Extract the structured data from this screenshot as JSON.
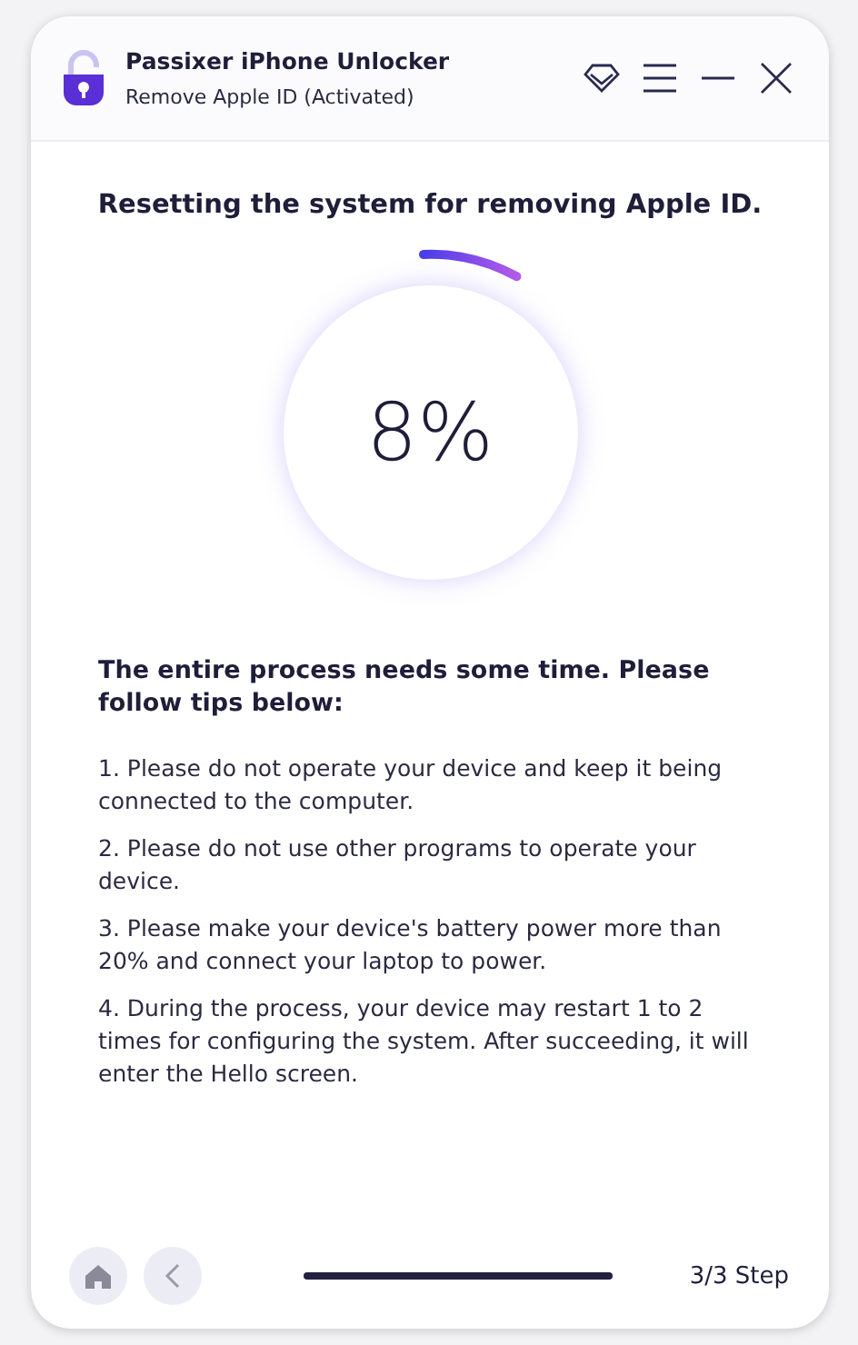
{
  "window": {
    "title": "Passixer iPhone Unlocker",
    "subtitle": "Remove Apple ID  (Activated)"
  },
  "heading": "Resetting the system for removing Apple ID.",
  "progress": {
    "reading": "8%"
  },
  "tips_title": "The entire process needs some time. Please follow tips below:",
  "tips": [
    "1. Please do not operate your device and keep it being connected to the computer.",
    "2. Please do not use other programs to operate your device.",
    "3. Please make your device's battery power more than 20% and connect your laptop to power.",
    "4. During the process, your device may restart 1 to 2 times for configuring the system. After succeeding, it will enter the Hello screen."
  ],
  "footer": {
    "step_bar": {
      "level": 1
    },
    "step": "3/3 Step"
  }
}
